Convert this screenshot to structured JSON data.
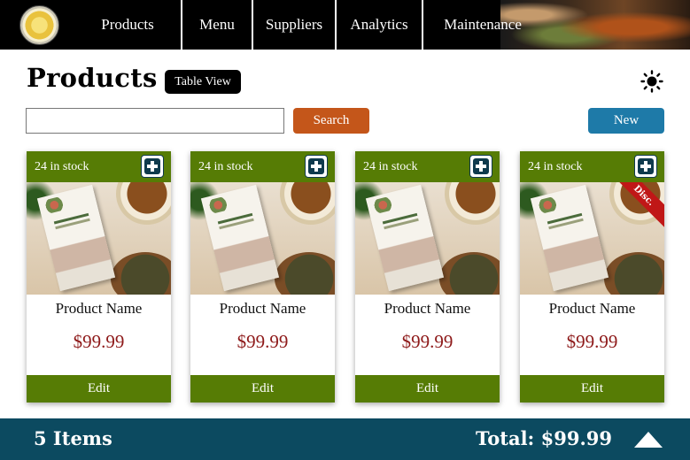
{
  "nav": {
    "items": [
      {
        "label": "Products"
      },
      {
        "label": "Menu"
      },
      {
        "label": "Suppliers"
      },
      {
        "label": "Analytics"
      },
      {
        "label": "Maintenance"
      }
    ]
  },
  "header": {
    "title": "Products",
    "view_toggle": "Table View",
    "theme_icon": "sun-icon"
  },
  "search": {
    "value": "",
    "placeholder": "",
    "button_label": "Search"
  },
  "new_button": "New",
  "products": [
    {
      "stock": "24 in stock",
      "name": "Product Name",
      "price": "$99.99",
      "edit": "Edit",
      "badge": ""
    },
    {
      "stock": "24 in stock",
      "name": "Product Name",
      "price": "$99.99",
      "edit": "Edit",
      "badge": ""
    },
    {
      "stock": "24 in stock",
      "name": "Product Name",
      "price": "$99.99",
      "edit": "Edit",
      "badge": ""
    },
    {
      "stock": "24 in stock",
      "name": "Product Name",
      "price": "$99.99",
      "edit": "Edit",
      "badge": "Disc."
    }
  ],
  "footer": {
    "items_count": "5 Items",
    "total": "Total: $99.99",
    "scroll_icon": "triangle-up-icon"
  },
  "colors": {
    "nav_bg": "#000000",
    "card_green": "#567c05",
    "price_red": "#8e1a1a",
    "search_orange": "#c4561a",
    "new_blue": "#1e7aa8",
    "footer_teal": "#0c4a60",
    "discount_red": "#c01717"
  }
}
